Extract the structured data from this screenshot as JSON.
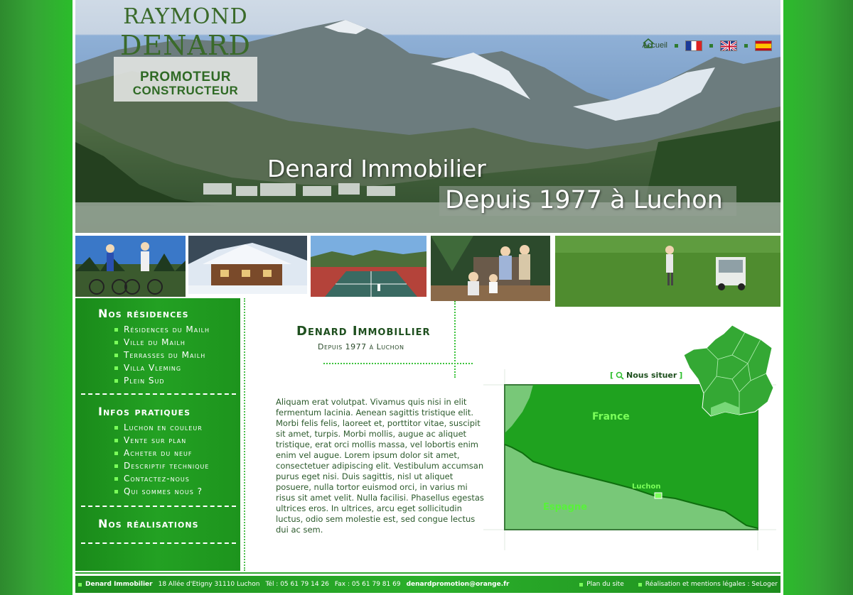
{
  "logo": {
    "line1": "RAYMOND",
    "line2": "DENARD",
    "line3": "PROMOTEUR",
    "line4": "CONSTRUCTEUR"
  },
  "topnav": {
    "home_label": "Accueil",
    "home_icon": "home-icon",
    "flags": [
      "flag-fr",
      "flag-uk",
      "flag-es"
    ]
  },
  "banner": {
    "line1": "Denard Immobilier",
    "line2": "Depuis 1977 à Luchon"
  },
  "photos": [
    "cyclists-photo",
    "chalet-photo",
    "tennis-photo",
    "family-photo",
    "golf-photo"
  ],
  "sidebar": {
    "sections": [
      {
        "title": "Nos résidences",
        "items": [
          "Résidences du Mailh",
          "Ville du Mailh",
          "Terrasses du Mailh",
          "Villa Vleming",
          "Plein Sud"
        ]
      },
      {
        "title": "Infos pratiques",
        "items": [
          "Luchon en couleur",
          "Vente sur plan",
          "Acheter du neuf",
          "Descriptif technique",
          "Contactez-nous",
          "Qui sommes nous ?"
        ]
      },
      {
        "title": "Nos réalisations",
        "items": []
      }
    ]
  },
  "main": {
    "title": "Denard Immobillier",
    "subtitle": "Depuis 1977 à Luchon",
    "body": "Aliquam erat volutpat. Vivamus quis nisi in elit fermentum lacinia. Aenean sagittis tristique elit. Morbi felis felis, laoreet et, porttitor vitae, suscipit sit amet, turpis. Morbi mollis, augue ac aliquet tristique, erat orci mollis massa, vel lobortis enim enim vel augue. Lorem ipsum dolor sit amet, consectetuer adipiscing elit. Vestibulum accumsan purus eget nisi. Duis sagittis, nisl ut aliquet posuere, nulla tortor euismod orci, in varius mi risus sit amet velit. Nulla facilisi. Phasellus egestas ultrices eros. In ultrices, arcu eget sollicitudin luctus, odio sem molestie est, sed congue lectus dui ac sem."
  },
  "map": {
    "locate_label": "Nous situer",
    "locate_bracket_open": "[",
    "locate_bracket_close": "]",
    "france": "France",
    "espagne": "Espagne",
    "luchon": "Luchon"
  },
  "footer": {
    "company": "Denard Immobilier",
    "address": "18 Allée d'Etigny 31110 Luchon",
    "tel": "Tél : 05 61 79 14 26",
    "fax": "Fax : 05 61 79 81 69",
    "email": "denardpromotion@orange.fr",
    "sitemap": "Plan du site",
    "credits": "Réalisation et mentions légales : SeLoger"
  },
  "colors": {
    "accent_green": "#23a123",
    "dark_green": "#1e4f1e",
    "bright_green": "#7bff5a"
  }
}
